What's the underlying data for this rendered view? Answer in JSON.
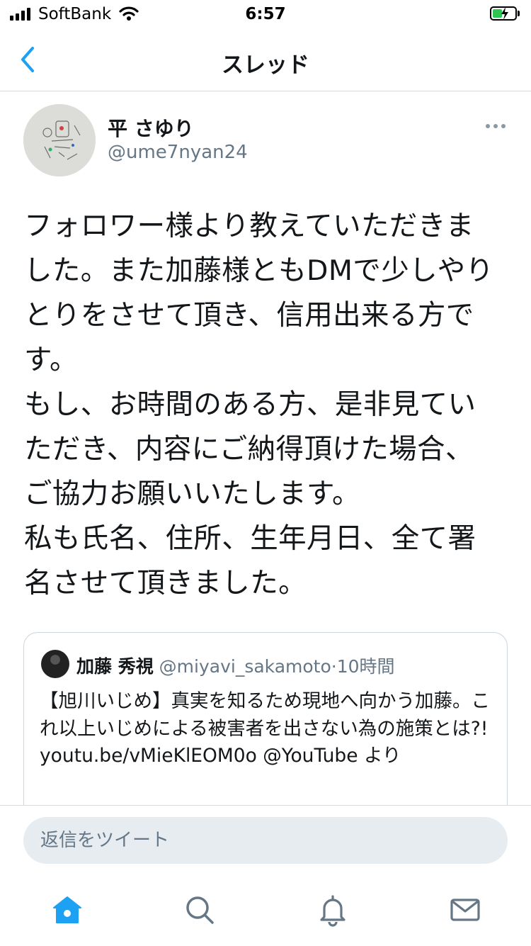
{
  "status_bar": {
    "carrier": "SoftBank",
    "time": "6:57",
    "battery_color": "#2dc653"
  },
  "header": {
    "title": "スレッド",
    "back_icon": "chevron-left-icon"
  },
  "tweet": {
    "display_name": "平 さゆり",
    "handle": "@ume7nyan24",
    "more_icon": "more-horizontal-icon",
    "text": "フォロワー様より教えていただきま\nした。また加藤様ともDMで少しやり\nとりをさせて頂き、信用出来る方で\nす。\nもし、お時間のある方、是非見てい\nただき、内容にご納得頂けた場合、\nご協力お願いいたします。\n私も氏名、住所、生年月日、全て署\n名させて頂きました。"
  },
  "quote": {
    "name": "加藤 秀視",
    "handle": "@miyavi_sakamoto",
    "separator": "·",
    "time": "10時間",
    "text": "【旭川いじめ】真実を知るため現地へ向かう加藤。これ以上いじめによる被害者を出さない為の施策とは?! youtu.be/vMieKlEOM0o @YouTube より"
  },
  "reply": {
    "placeholder": "返信をツイート"
  },
  "tabs": {
    "items": [
      "home-icon",
      "search-icon",
      "notifications-icon",
      "messages-icon"
    ],
    "active": "home-icon",
    "accent": "#1da1f2",
    "inactive": "#657786"
  }
}
